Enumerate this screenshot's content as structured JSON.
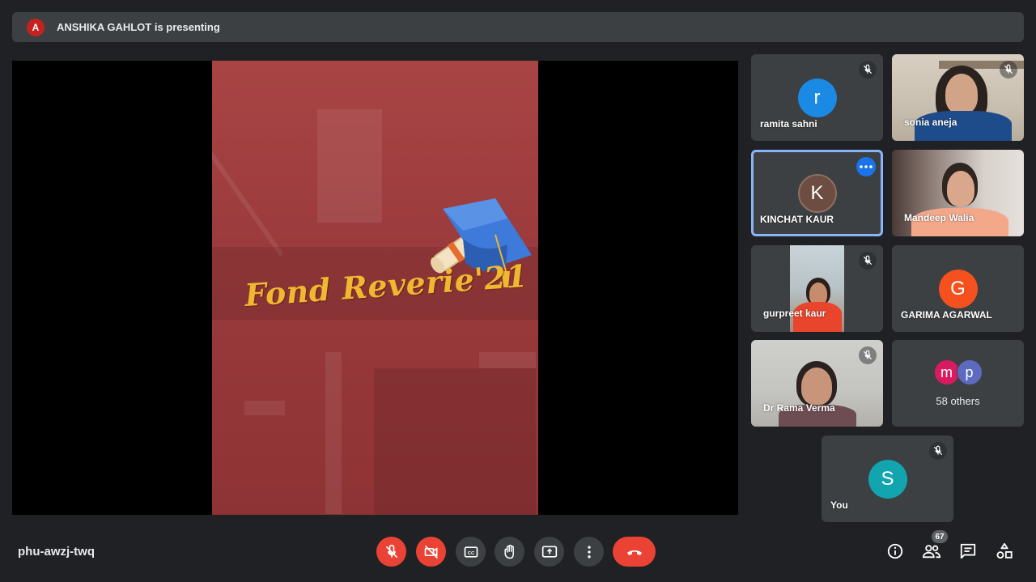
{
  "presenter_bar": {
    "avatar_letter": "A",
    "text": "ANSHIKA GAHLOT is presenting"
  },
  "slide": {
    "title": "Fond Reverie'21"
  },
  "participants": [
    {
      "name": "ramita sahni",
      "initial": "r",
      "avatar_color": "#1a8ae5",
      "muted": true
    },
    {
      "name": "sonia aneja",
      "video": true,
      "muted": true
    },
    {
      "name": "KINCHAT KAUR",
      "initial": "K",
      "avatar_color": "#6d4c41",
      "speaking": true
    },
    {
      "name": "Mandeep Walia",
      "video": true
    },
    {
      "name": "gurpreet kaur",
      "video": true,
      "muted": true
    },
    {
      "name": "GARIMA AGARWAL",
      "initial": "G",
      "avatar_color": "#f4511e"
    },
    {
      "name": "Dr Rama Verma",
      "video": true,
      "muted": true
    },
    {
      "others_label": "58 others",
      "avatars": [
        {
          "initial": "m",
          "color": "#d81b60"
        },
        {
          "initial": "p",
          "color": "#5c6bc0"
        }
      ]
    },
    {
      "name": "You",
      "initial": "S",
      "avatar_color": "#12a4af",
      "muted": true
    }
  ],
  "meeting_code": "phu-awzj-twq",
  "participant_count": "67",
  "colors": {
    "background": "#202124",
    "tile": "#3c4043",
    "danger": "#ea4335",
    "speaking_border": "#8ab4f8"
  }
}
